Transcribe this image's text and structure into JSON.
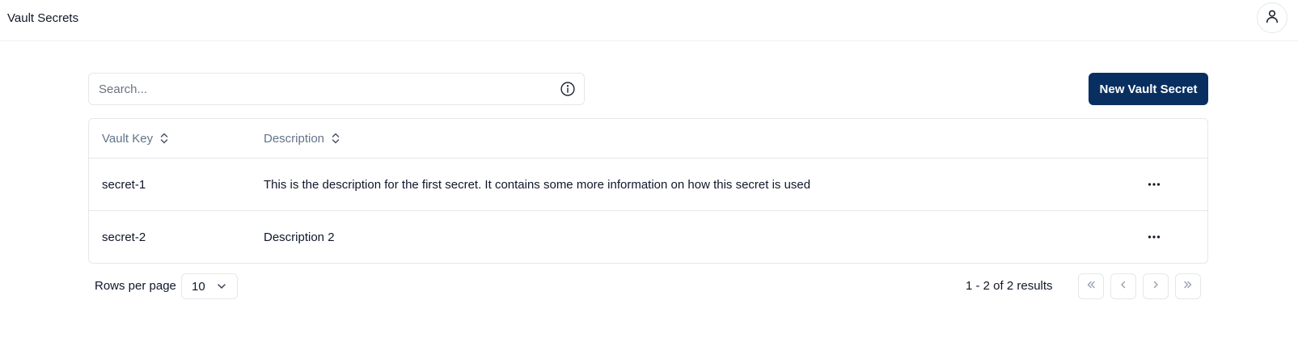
{
  "header": {
    "title": "Vault Secrets",
    "user_icon": "user-icon"
  },
  "toolbar": {
    "search_placeholder": "Search...",
    "search_value": "",
    "info_icon": "info-icon",
    "new_button_label": "New Vault Secret",
    "new_button_color": "#082f5f"
  },
  "table": {
    "columns": [
      {
        "label": "Vault Key",
        "sort_icon": "sort-icon"
      },
      {
        "label": "Description",
        "sort_icon": "sort-icon"
      }
    ],
    "rows": [
      {
        "key": "secret-1",
        "description": "This is the description for the first secret. It contains some more information on how this secret is used",
        "actions_icon": "more-icon"
      },
      {
        "key": "secret-2",
        "description": "Description 2",
        "actions_icon": "more-icon"
      }
    ]
  },
  "pagination": {
    "rows_per_page_label": "Rows per page",
    "rows_per_page_value": "10",
    "results_text": "1 - 2 of 2 results"
  }
}
